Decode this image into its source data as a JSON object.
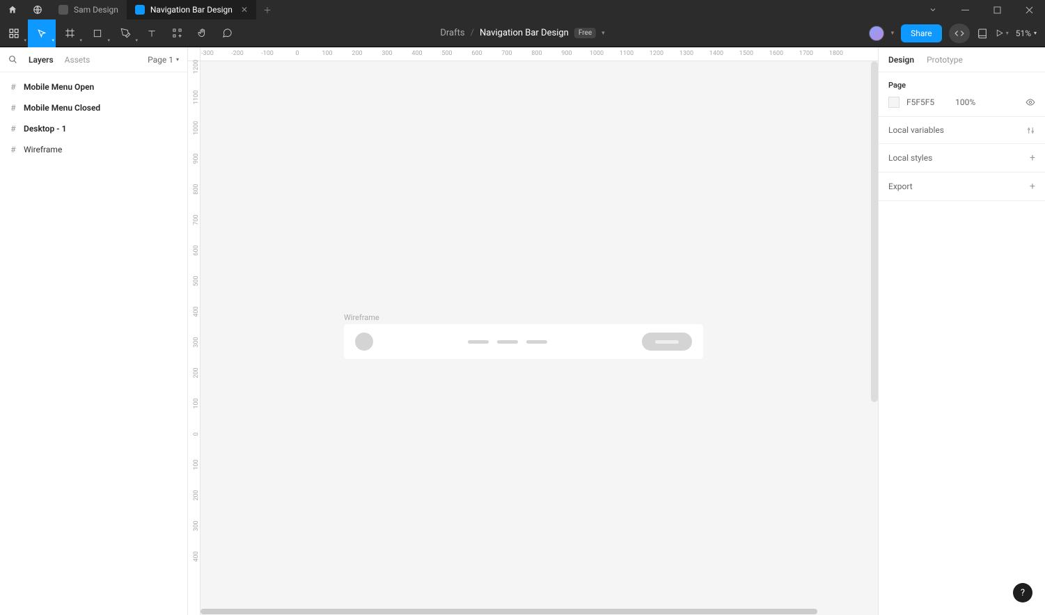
{
  "titlebar": {
    "tabs": [
      {
        "name": "Sam Design",
        "active": false
      },
      {
        "name": "Navigation Bar Design",
        "active": true
      }
    ]
  },
  "toolbar": {
    "breadcrumb_folder": "Drafts",
    "filename": "Navigation Bar Design",
    "plan_badge": "Free",
    "share_label": "Share",
    "zoom": "51%"
  },
  "left_panel": {
    "tab_layers": "Layers",
    "tab_assets": "Assets",
    "page_selector": "Page 1",
    "layers": [
      {
        "name": "Mobile Menu Open",
        "bold": true
      },
      {
        "name": "Mobile Menu Closed",
        "bold": true
      },
      {
        "name": "Desktop - 1",
        "bold": true
      },
      {
        "name": "Wireframe",
        "bold": false
      }
    ]
  },
  "canvas": {
    "frame_label": "Wireframe",
    "ruler_h": [
      "-300",
      "-200",
      "-100",
      "0",
      "100",
      "200",
      "300",
      "400",
      "500",
      "600",
      "700",
      "800",
      "900",
      "1000",
      "1100",
      "1200",
      "1300",
      "1400",
      "1500",
      "1600",
      "1700",
      "1800"
    ],
    "ruler_v": [
      "1200",
      "1100",
      "1000",
      "900",
      "800",
      "700",
      "600",
      "500",
      "400",
      "300",
      "200",
      "100",
      "0",
      "100",
      "200",
      "300",
      "400"
    ]
  },
  "right_panel": {
    "tab_design": "Design",
    "tab_prototype": "Prototype",
    "page_section_title": "Page",
    "page_color_hex": "F5F5F5",
    "page_color_opacity": "100%",
    "local_variables": "Local variables",
    "local_styles": "Local styles",
    "export": "Export"
  },
  "help": "?"
}
